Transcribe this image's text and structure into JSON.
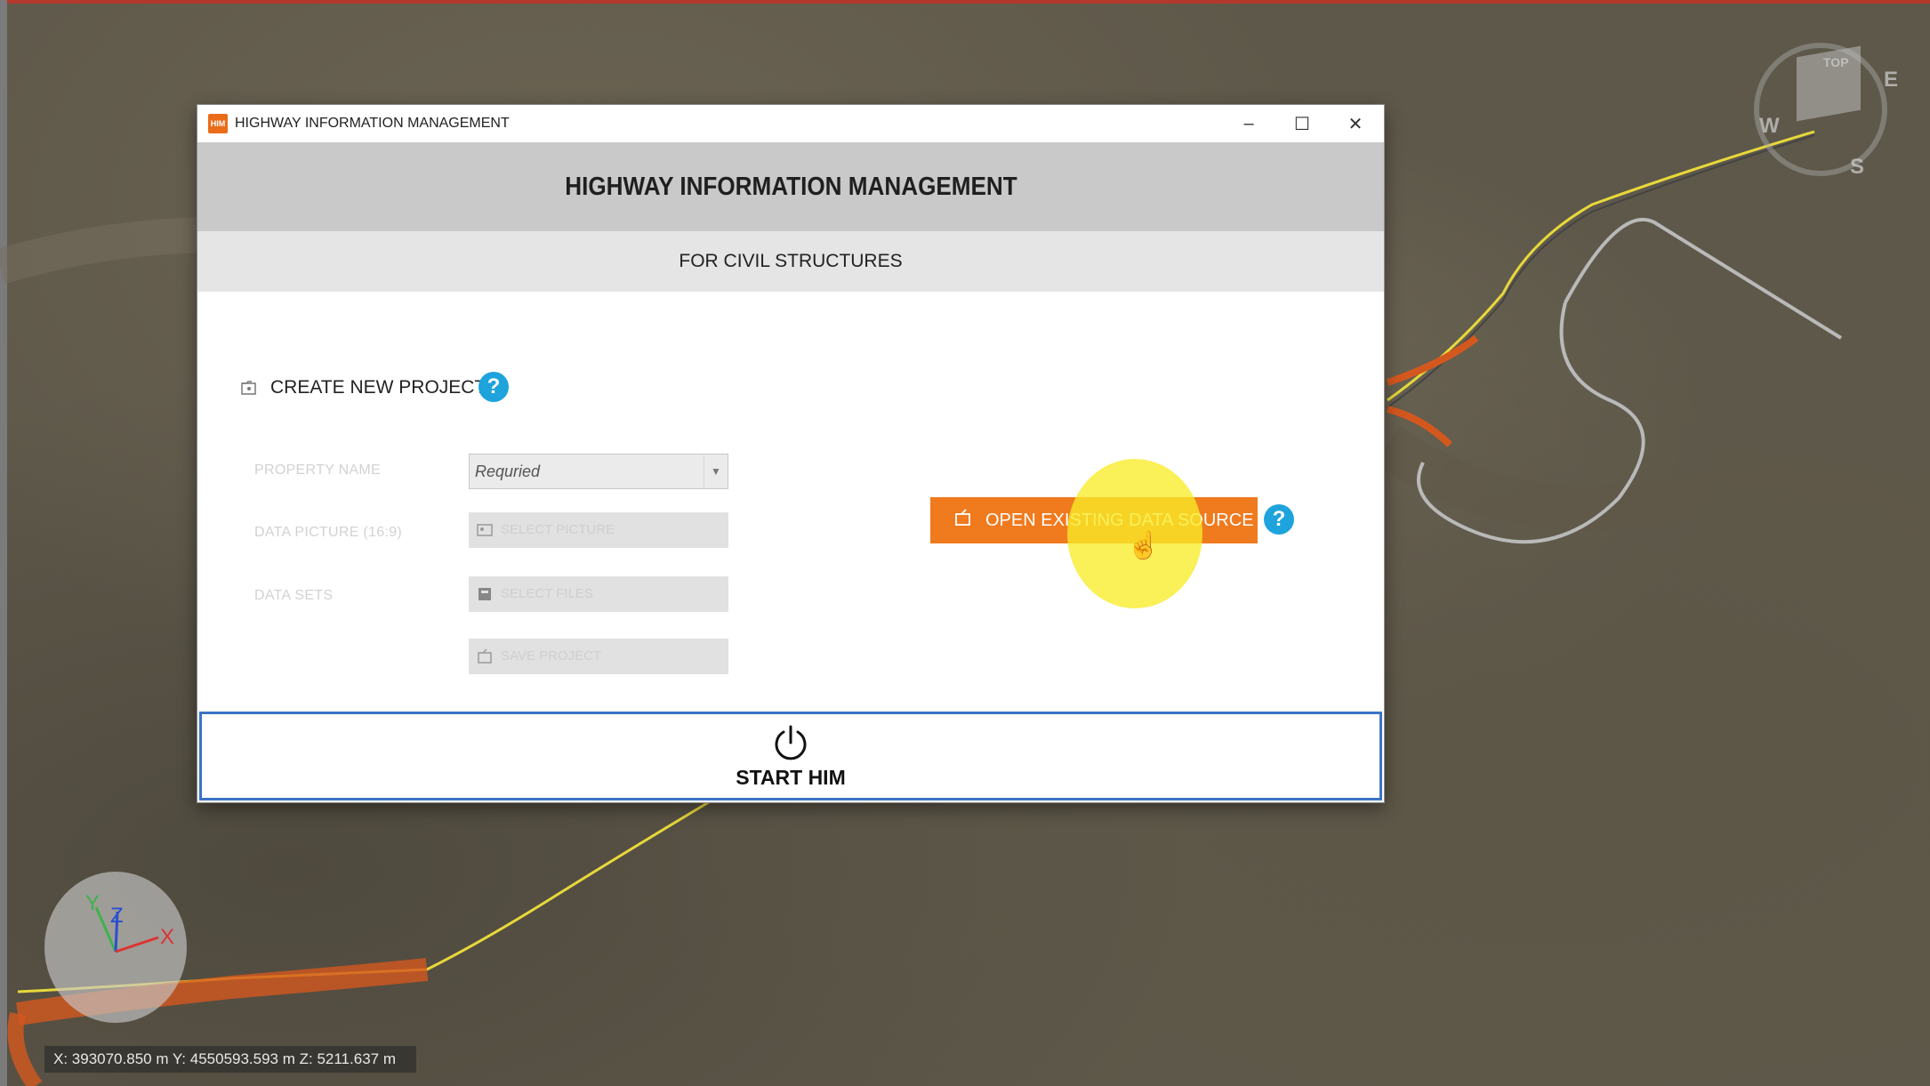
{
  "window": {
    "title": "HIGHWAY INFORMATION MANAGEMENT",
    "app_icon_label": "HIM",
    "minimize": "–",
    "maximize": "☐",
    "close": "✕"
  },
  "header": {
    "title": "HIGHWAY INFORMATION MANAGEMENT",
    "subtitle": "FOR CIVIL STRUCTURES"
  },
  "create_project": {
    "label": "CREATE NEW PROJECT",
    "help": "?",
    "fields": {
      "property_name_label": "PROPERTY NAME",
      "property_name_value": "Requried",
      "data_picture_label": "DATA PICTURE (16:9)",
      "data_picture_button": "SELECT PICTURE",
      "data_sets_label": "DATA SETS",
      "data_sets_button": "SELECT FILES",
      "save_button": "SAVE PROJECT"
    }
  },
  "open_existing": {
    "label": "OPEN EXISTING DATA SOURCE",
    "help": "?"
  },
  "start": {
    "label": "START HIM"
  },
  "compass": {
    "top": "TOP",
    "w": "W",
    "s": "S",
    "e": "E"
  },
  "axes": {
    "x": "X",
    "y": "Y",
    "z": "Z"
  },
  "status": {
    "coords": "X: 393070.850 m  Y: 4550593.593 m  Z: 5211.637 m"
  },
  "icons": {
    "app": "app-logo-icon",
    "create": "folder-new-icon",
    "picture": "picture-icon",
    "datasets": "database-icon",
    "save": "save-icon",
    "open": "folder-open-icon",
    "power": "power-icon",
    "cursor": "hand-cursor-icon"
  },
  "colors": {
    "accent_orange": "#f07a1e",
    "help_blue": "#1ea3dc",
    "start_border": "#3b74c6",
    "header_grey": "#c9c9c9",
    "subheader_grey": "#e5e5e5"
  }
}
